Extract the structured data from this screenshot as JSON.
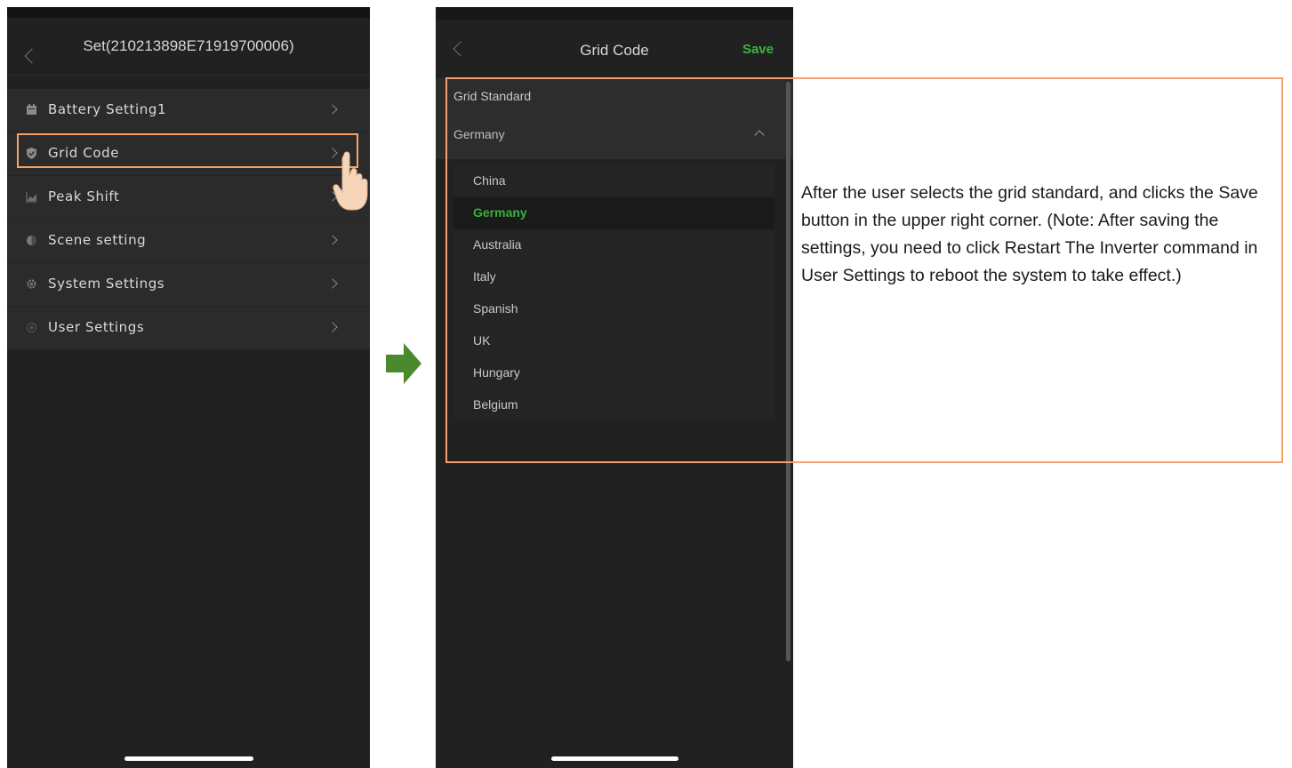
{
  "screen1": {
    "title": "Set(210213898E71919700006)",
    "menu": [
      {
        "label": "Battery Setting1",
        "icon": "battery-icon"
      },
      {
        "label": "Grid Code",
        "icon": "shield-icon"
      },
      {
        "label": "Peak Shift",
        "icon": "chart-icon"
      },
      {
        "label": "Scene setting",
        "icon": "scene-icon"
      },
      {
        "label": "System Settings",
        "icon": "gear-icon"
      },
      {
        "label": "User Settings",
        "icon": "user-settings-icon"
      }
    ]
  },
  "screen2": {
    "title": "Grid Code",
    "save_label": "Save",
    "grid_standard_label": "Grid Standard",
    "grid_standard_value": "Germany",
    "options": [
      "China",
      "Germany",
      "Australia",
      "Italy",
      "Spanish",
      "UK",
      "Hungary",
      "Belgium"
    ],
    "selected_option": "Germany"
  },
  "note": "After the user selects the grid standard, and clicks the Save button in the upper right corner. (Note: After saving the settings, you need to click Restart The Inverter command in User Settings to reboot the system to take effect.)",
  "colors": {
    "accent_green": "#3cb43c",
    "highlight_orange": "#f2a26a",
    "arrow_green": "#4a8a2c"
  }
}
